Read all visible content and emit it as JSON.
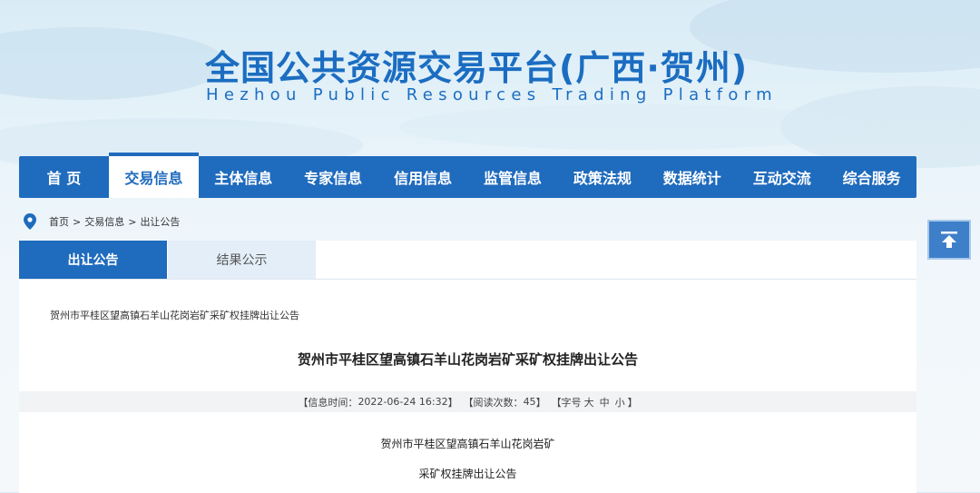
{
  "header": {
    "title": "全国公共资源交易平台(广西·贺州)",
    "subtitle": "Hezhou Public Resources Trading Platform"
  },
  "nav": {
    "items": [
      {
        "label": "首 页",
        "active": false
      },
      {
        "label": "交易信息",
        "active": true
      },
      {
        "label": "主体信息",
        "active": false
      },
      {
        "label": "专家信息",
        "active": false
      },
      {
        "label": "信用信息",
        "active": false
      },
      {
        "label": "监管信息",
        "active": false
      },
      {
        "label": "政策法规",
        "active": false
      },
      {
        "label": "数据统计",
        "active": false
      },
      {
        "label": "互动交流",
        "active": false
      },
      {
        "label": "综合服务",
        "active": false
      }
    ]
  },
  "breadcrumb": {
    "icon": "location-pin-icon",
    "items": [
      "首页",
      "交易信息",
      "出让公告"
    ],
    "separator": ">"
  },
  "tabs": [
    {
      "label": "出让公告",
      "active": true
    },
    {
      "label": "结果公示",
      "active": false
    }
  ],
  "article": {
    "breadcrumb_title": "贺州市平桂区望高镇石羊山花岗岩矿采矿权挂牌出让公告",
    "title": "贺州市平桂区望高镇石羊山花岗岩矿采矿权挂牌出让公告",
    "meta": {
      "time_label": "【信息时间：",
      "time_value": "2022-06-24 16:32",
      "time_close": "】",
      "reads_label": "【阅读次数：",
      "reads_value": "45",
      "reads_close": "】",
      "fontsize_label": "【字号",
      "fontsize_large": "大",
      "fontsize_medium": "中",
      "fontsize_small": "小",
      "fontsize_close": "】"
    },
    "body_line1": "贺州市平桂区望高镇石羊山花岗岩矿",
    "body_line2": "采矿权挂牌出让公告"
  },
  "colors": {
    "primary": "#1f6bbd",
    "title_blue": "#1b6dc1",
    "tab_inactive": "#e3eef8",
    "meta_bg": "#f1f3f5"
  },
  "back_to_top": {
    "icon": "arrow-up-icon"
  }
}
